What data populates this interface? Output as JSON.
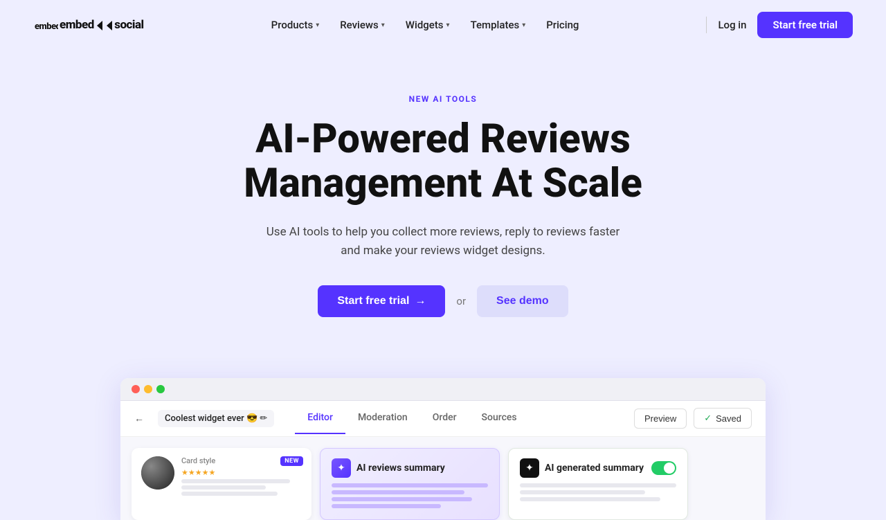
{
  "brand": {
    "logo_text": "embed◁▷social"
  },
  "nav": {
    "links": [
      {
        "id": "products",
        "label": "Products",
        "has_dropdown": true
      },
      {
        "id": "reviews",
        "label": "Reviews",
        "has_dropdown": true
      },
      {
        "id": "widgets",
        "label": "Widgets",
        "has_dropdown": true
      },
      {
        "id": "templates",
        "label": "Templates",
        "has_dropdown": true
      },
      {
        "id": "pricing",
        "label": "Pricing",
        "has_dropdown": false
      }
    ],
    "login_label": "Log in",
    "trial_label": "Start free trial"
  },
  "hero": {
    "badge": "NEW AI TOOLS",
    "title_line1": "AI-Powered Reviews",
    "title_line2": "Management At Scale",
    "subtitle": "Use AI tools to help you collect more reviews, reply to reviews faster and make your reviews widget designs.",
    "cta_trial": "Start free trial",
    "cta_arrow": "→",
    "or_text": "or",
    "cta_demo": "See demo"
  },
  "editor": {
    "back_arrow": "←",
    "widget_name": "Coolest widget ever 😎 ✏",
    "tabs": [
      {
        "id": "editor",
        "label": "Editor",
        "active": true
      },
      {
        "id": "moderation",
        "label": "Moderation",
        "active": false
      },
      {
        "id": "order",
        "label": "Order",
        "active": false
      },
      {
        "id": "sources",
        "label": "Sources",
        "active": false
      }
    ],
    "preview_label": "Preview",
    "saved_label": "Saved",
    "check": "✓"
  },
  "widget_cards": {
    "card1": {
      "label": "Card style",
      "badge": "NEW",
      "stars": "★★★★★"
    },
    "card2": {
      "icon": "✦",
      "title": "AI reviews summary"
    },
    "card3": {
      "icon": "✦",
      "title": "AI generated summary"
    }
  },
  "browser_dots": {
    "red": "#ff5f57",
    "yellow": "#febc2e",
    "green": "#28c840"
  }
}
